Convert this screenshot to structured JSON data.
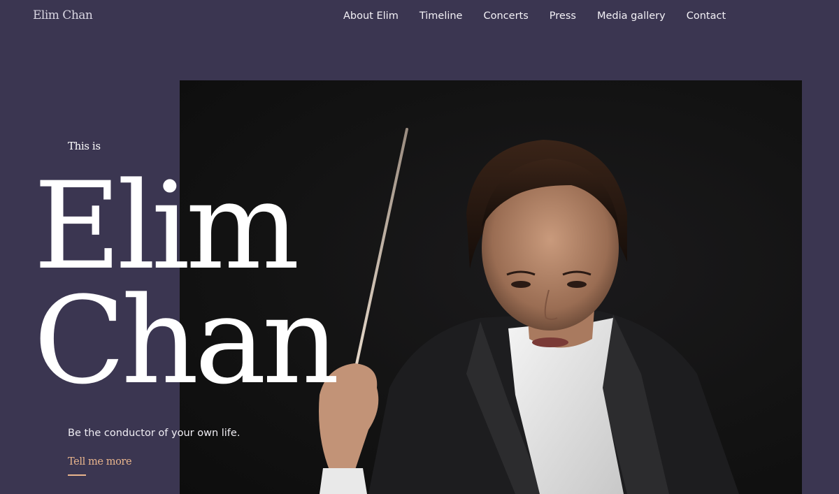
{
  "header": {
    "logo": "Elim Chan",
    "nav": [
      "About Elim",
      "Timeline",
      "Concerts",
      "Press",
      "Media gallery",
      "Contact"
    ]
  },
  "hero": {
    "intro": "This is",
    "first_name": "Elim",
    "last_name": "Chan",
    "tagline": "Be the conductor of your own life.",
    "cta": "Tell me more"
  },
  "colors": {
    "background": "#3b3651",
    "accent": "#e9b58d",
    "text": "#ffffff"
  }
}
